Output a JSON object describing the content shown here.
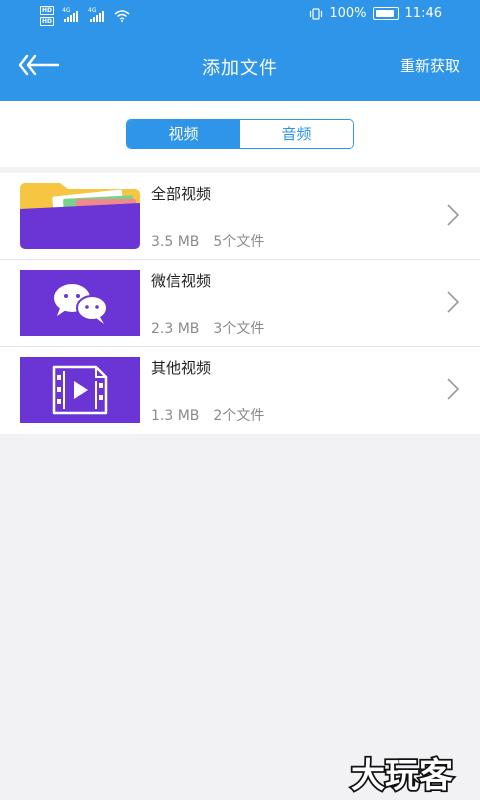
{
  "status": {
    "hd1": "HD",
    "hd2": "HD",
    "net1": "4G",
    "net2": "4G",
    "battery": "100%",
    "time": "11:46"
  },
  "header": {
    "title": "添加文件",
    "refresh_label": "重新获取"
  },
  "tabs": [
    {
      "label": "视频",
      "selected": true
    },
    {
      "label": "音频",
      "selected": false
    }
  ],
  "items": [
    {
      "name": "全部视频",
      "size": "3.5 MB",
      "count": "5个文件",
      "icon": "folder-icon"
    },
    {
      "name": "微信视频",
      "size": "2.3 MB",
      "count": "3个文件",
      "icon": "wechat-icon"
    },
    {
      "name": "其他视频",
      "size": "1.3 MB",
      "count": "2个文件",
      "icon": "video-file-icon"
    }
  ],
  "watermark": "大玩客",
  "colors": {
    "accent": "#2f95e8",
    "purple": "#6a35d4",
    "folder_yellow": "#f6c542"
  }
}
